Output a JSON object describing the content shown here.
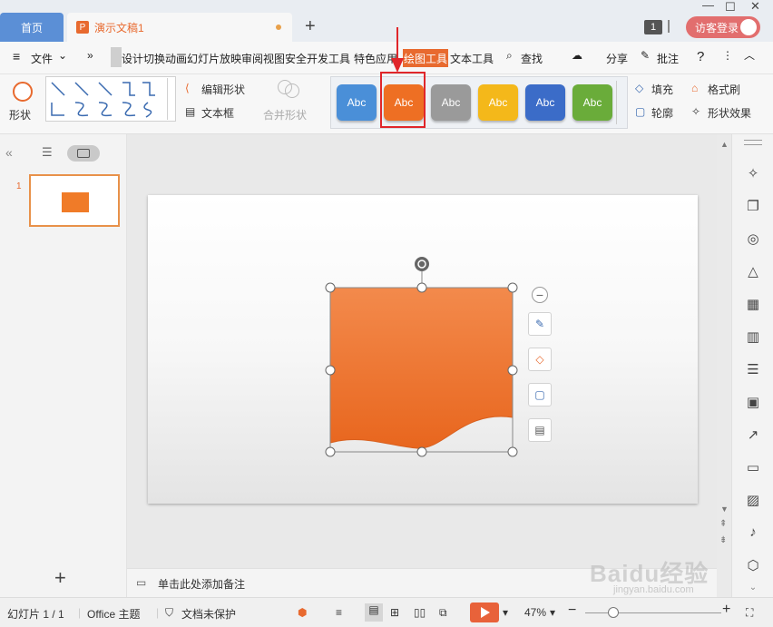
{
  "titlebar": {
    "home_tab": "首页",
    "doc_tab": "演示文稿1",
    "file_icon_letter": "P",
    "new_tab": "+",
    "window_count": "1",
    "login": "访客登录"
  },
  "menu": {
    "file": "文件",
    "more": "»",
    "tabs": [
      "设计",
      "切换",
      "动画",
      "幻灯片放映",
      "审阅",
      "视图",
      "安全",
      "开发工具",
      "特色应用"
    ],
    "active_tab": "绘图工具",
    "text_tool": "文本工具",
    "search": "查找",
    "share": "分享",
    "comment": "批注",
    "help": "?"
  },
  "ribbon": {
    "shape": "形状",
    "edit_shape": "编辑形状",
    "textbox": "文本框",
    "merge_shape": "合并形状",
    "styles": [
      {
        "label": "Abc",
        "color": "#4a8fd8"
      },
      {
        "label": "Abc",
        "color": "#ee6f23"
      },
      {
        "label": "Abc",
        "color": "#9a9a9a"
      },
      {
        "label": "Abc",
        "color": "#f4b81a"
      },
      {
        "label": "Abc",
        "color": "#3b6cc8"
      },
      {
        "label": "Abc",
        "color": "#6aac3a"
      }
    ],
    "fill": "填充",
    "outline": "轮廓",
    "format_painter": "格式刷",
    "shape_effects": "形状效果"
  },
  "slides": {
    "number": "1"
  },
  "notes": {
    "placeholder": "单击此处添加备注"
  },
  "status": {
    "slide_count": "幻灯片 1 / 1",
    "theme": "Office 主题",
    "protection": "文档未保护",
    "zoom": "47%",
    "zoom_level": 0.47
  },
  "watermark": {
    "main": "Baidu经验",
    "sub": "jingyan.baidu.com"
  },
  "colors": {
    "accent": "#e86a2f",
    "shape_fill": "#f07b28",
    "highlight": "#e0262a"
  }
}
